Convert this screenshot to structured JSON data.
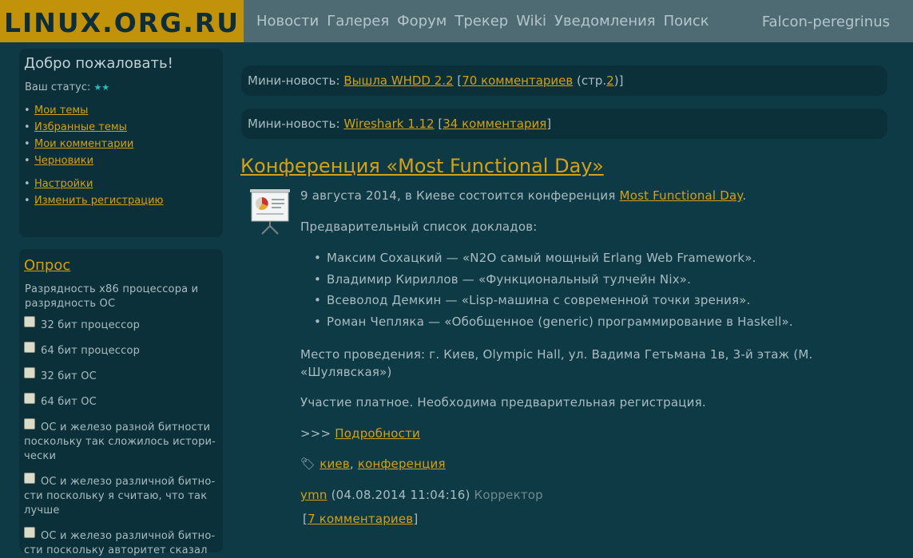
{
  "header": {
    "logo": "LINUX.ORG.RU",
    "nav": [
      "Новости",
      "Галерея",
      "Форум",
      "Трекер",
      "Wiki",
      "Уведомления",
      "Поиск"
    ],
    "username": "Falcon-peregrinus"
  },
  "sidebar": {
    "welcome": {
      "title": "Добро пожаловать!",
      "status_label": "Ваш статус:",
      "status_stars": "★★",
      "links": [
        "Мои темы",
        "Избранные темы",
        "Мои комментарии",
        "Черновики"
      ],
      "links2": [
        "Настройки",
        "Изменить регистрацию"
      ]
    },
    "poll": {
      "title": "Опрос",
      "question": "Разрядность x86 процессора и разрядность ОС",
      "options": [
        "32 бит процессор",
        "64 бит процессор",
        "32 бит ОС",
        "64 бит ОС",
        "ОС и железо разной битности поскольку так сложилось истори-чески",
        "ОС и железо различной битно-сти поскольку я считаю, что так лучше",
        "ОС и железо различной битно-сти поскольку авторитет сказал"
      ]
    }
  },
  "mini_news": [
    {
      "prefix": "Мини-новость:",
      "title": "Вышла WHDD 2.2",
      "comments": "70 комментариев",
      "pages_label": "(стр.",
      "page": "2",
      "pages_close": ")"
    },
    {
      "prefix": "Мини-новость:",
      "title": "Wireshark 1.12",
      "comments": "34 комментария"
    }
  ],
  "article": {
    "title": "Конференция «Most Functional Day»",
    "intro_text": "9 августа 2014, в Киеве состоится конференция ",
    "intro_link": "Most Functional Day",
    "intro_end": ".",
    "list_heading": "Предварительный список докладов:",
    "reports": [
      "Максим Сохацкий — «N2O самый мощный Erlang Web Framework».",
      "Владимир Кириллов — «Функциональный тулчейн Nix».",
      "Всеволод Демкин — «Lisp-машина с современной точки зрения».",
      "Роман Чепляка — «Обобщенное (generic) программирование в Haskell»."
    ],
    "venue": "Место проведения: г. Киев, Olympic Hall, ул. Вадима Гетьмана 1в, 3-й этаж (М. «Шулявская»)",
    "payment": "Участие платное. Необходима предварительная регистрация.",
    "more_prefix": ">>>",
    "more_link": "Подробности",
    "tags": [
      "киев",
      "конференция"
    ],
    "author": "ymn",
    "date": "(04.08.2014 11:04:16)",
    "role": "Корректор",
    "comments": "7 комментариев"
  }
}
